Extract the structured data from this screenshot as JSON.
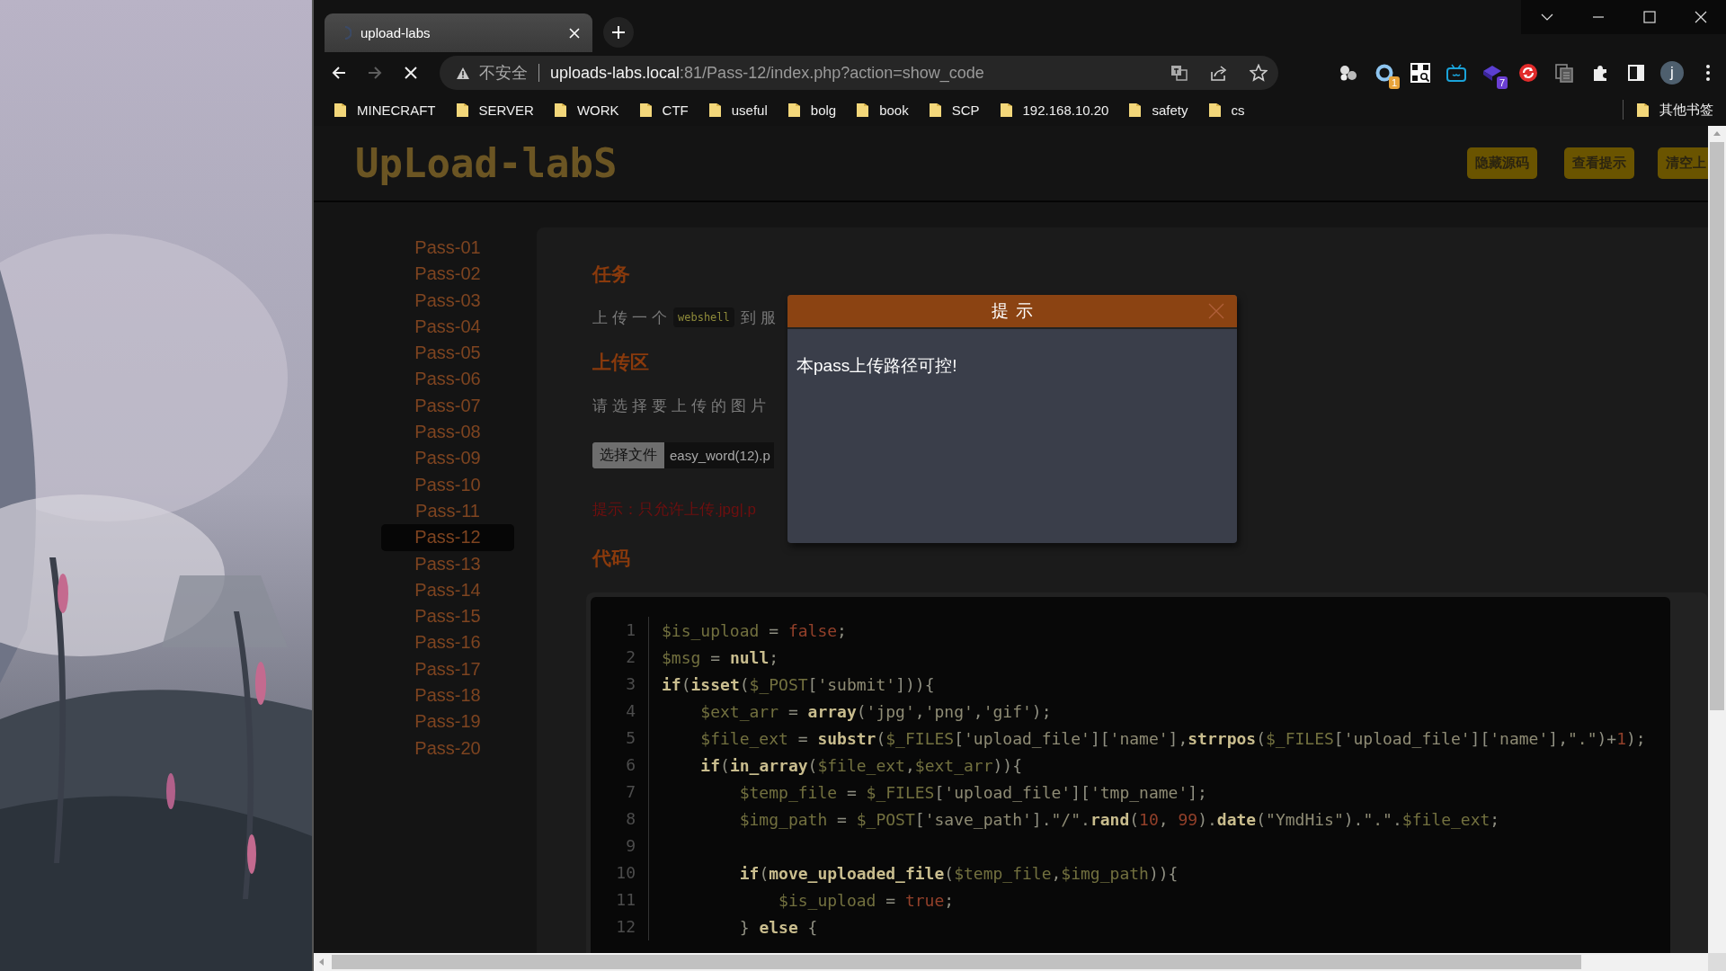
{
  "browser": {
    "tabs": [
      {
        "title": "upload-labs",
        "selected": true,
        "loading": true
      }
    ],
    "nav_buttons": [
      {
        "kind": "back",
        "disabled": false
      },
      {
        "kind": "forward",
        "disabled": true
      },
      {
        "kind": "stop",
        "disabled": false
      }
    ],
    "address_bar": {
      "security_label": "不安全",
      "host": "uploads-labs.local",
      "path": ":81/Pass-12/index.php?action=show_code"
    },
    "extensions": [
      {
        "kind": "bubbles"
      },
      {
        "kind": "ring",
        "badge": "1",
        "color": "#e8a33a"
      },
      {
        "kind": "qr"
      },
      {
        "kind": "tv"
      },
      {
        "kind": "cube",
        "badge": "7",
        "color": "#6b3fd4"
      },
      {
        "kind": "sync"
      },
      {
        "kind": "docs"
      }
    ],
    "profile_initial": "j",
    "bookmarks": [
      "MINECRAFT",
      "SERVER",
      "WORK",
      "CTF",
      "useful",
      "bolg",
      "book",
      "SCP",
      "192.168.10.20",
      "safety",
      "cs"
    ],
    "other_bookmarks": "其他书签"
  },
  "page": {
    "logo": "UpLoad-labS",
    "header_buttons": [
      "隐藏源码",
      "查看提示",
      "清空上"
    ],
    "passes": [
      {
        "label": "Pass-01",
        "selected": false
      },
      {
        "label": "Pass-02",
        "selected": false
      },
      {
        "label": "Pass-03",
        "selected": false
      },
      {
        "label": "Pass-04",
        "selected": false
      },
      {
        "label": "Pass-05",
        "selected": false
      },
      {
        "label": "Pass-06",
        "selected": false
      },
      {
        "label": "Pass-07",
        "selected": false
      },
      {
        "label": "Pass-08",
        "selected": false
      },
      {
        "label": "Pass-09",
        "selected": false
      },
      {
        "label": "Pass-10",
        "selected": false
      },
      {
        "label": "Pass-11",
        "selected": false
      },
      {
        "label": "Pass-12",
        "selected": true
      },
      {
        "label": "Pass-13",
        "selected": false
      },
      {
        "label": "Pass-14",
        "selected": false
      },
      {
        "label": "Pass-15",
        "selected": false
      },
      {
        "label": "Pass-16",
        "selected": false
      },
      {
        "label": "Pass-17",
        "selected": false
      },
      {
        "label": "Pass-18",
        "selected": false
      },
      {
        "label": "Pass-19",
        "selected": false
      },
      {
        "label": "Pass-20",
        "selected": false
      }
    ],
    "task": {
      "heading": "任务",
      "text_before": "上传一个",
      "code": "webshell",
      "text_after": "到服"
    },
    "upload": {
      "heading": "上传区",
      "prompt": "请选择要上传的图片",
      "file_button": "选择文件",
      "file_name": "easy_word(12).p",
      "hint": "提示：只允许上传.jpg|.p"
    },
    "code": {
      "heading": "代码",
      "lines": [
        {
          "number": "1",
          "segments": [
            {
              "text": "$is_upload",
              "kind": "var"
            },
            {
              "text": " = ",
              "kind": "plain"
            },
            {
              "text": "false",
              "kind": "lit"
            },
            {
              "text": ";",
              "kind": "plain"
            }
          ]
        },
        {
          "number": "2",
          "segments": [
            {
              "text": "$msg",
              "kind": "var"
            },
            {
              "text": " = ",
              "kind": "plain"
            },
            {
              "text": "null",
              "kind": "kw"
            },
            {
              "text": ";",
              "kind": "plain"
            }
          ]
        },
        {
          "number": "3",
          "segments": [
            {
              "text": "if",
              "kind": "kw"
            },
            {
              "text": "(",
              "kind": "plain"
            },
            {
              "text": "isset",
              "kind": "kw"
            },
            {
              "text": "(",
              "kind": "plain"
            },
            {
              "text": "$_POST",
              "kind": "var"
            },
            {
              "text": "[",
              "kind": "plain"
            },
            {
              "text": "'submit'",
              "kind": "str"
            },
            {
              "text": "])){",
              "kind": "plain"
            }
          ]
        },
        {
          "number": "4",
          "segments": [
            {
              "text": "    $ext_arr",
              "kind": "var"
            },
            {
              "text": " = ",
              "kind": "plain"
            },
            {
              "text": "array",
              "kind": "kw"
            },
            {
              "text": "(",
              "kind": "plain"
            },
            {
              "text": "'jpg'",
              "kind": "str"
            },
            {
              "text": ",",
              "kind": "plain"
            },
            {
              "text": "'png'",
              "kind": "str"
            },
            {
              "text": ",",
              "kind": "plain"
            },
            {
              "text": "'gif'",
              "kind": "str"
            },
            {
              "text": ");",
              "kind": "plain"
            }
          ]
        },
        {
          "number": "5",
          "segments": [
            {
              "text": "    $file_ext",
              "kind": "var"
            },
            {
              "text": " = ",
              "kind": "plain"
            },
            {
              "text": "substr",
              "kind": "kw"
            },
            {
              "text": "(",
              "kind": "plain"
            },
            {
              "text": "$_FILES",
              "kind": "var"
            },
            {
              "text": "[",
              "kind": "plain"
            },
            {
              "text": "'upload_file'",
              "kind": "str"
            },
            {
              "text": "][",
              "kind": "plain"
            },
            {
              "text": "'name'",
              "kind": "str"
            },
            {
              "text": "],",
              "kind": "plain"
            },
            {
              "text": "strrpos",
              "kind": "kw"
            },
            {
              "text": "(",
              "kind": "plain"
            },
            {
              "text": "$_FILES",
              "kind": "var"
            },
            {
              "text": "[",
              "kind": "plain"
            },
            {
              "text": "'upload_file'",
              "kind": "str"
            },
            {
              "text": "][",
              "kind": "plain"
            },
            {
              "text": "'name'",
              "kind": "str"
            },
            {
              "text": "],",
              "kind": "plain"
            },
            {
              "text": "\".\"",
              "kind": "str"
            },
            {
              "text": ")+",
              "kind": "plain"
            },
            {
              "text": "1",
              "kind": "lit"
            },
            {
              "text": ");",
              "kind": "plain"
            }
          ]
        },
        {
          "number": "6",
          "segments": [
            {
              "text": "    if",
              "kind": "kw"
            },
            {
              "text": "(",
              "kind": "plain"
            },
            {
              "text": "in_array",
              "kind": "kw"
            },
            {
              "text": "(",
              "kind": "plain"
            },
            {
              "text": "$file_ext",
              "kind": "var"
            },
            {
              "text": ",",
              "kind": "plain"
            },
            {
              "text": "$ext_arr",
              "kind": "var"
            },
            {
              "text": ")){",
              "kind": "plain"
            }
          ]
        },
        {
          "number": "7",
          "segments": [
            {
              "text": "        $temp_file",
              "kind": "var"
            },
            {
              "text": " = ",
              "kind": "plain"
            },
            {
              "text": "$_FILES",
              "kind": "var"
            },
            {
              "text": "[",
              "kind": "plain"
            },
            {
              "text": "'upload_file'",
              "kind": "str"
            },
            {
              "text": "][",
              "kind": "plain"
            },
            {
              "text": "'tmp_name'",
              "kind": "str"
            },
            {
              "text": "];",
              "kind": "plain"
            }
          ]
        },
        {
          "number": "8",
          "segments": [
            {
              "text": "        $img_path",
              "kind": "var"
            },
            {
              "text": " = ",
              "kind": "plain"
            },
            {
              "text": "$_POST",
              "kind": "var"
            },
            {
              "text": "[",
              "kind": "plain"
            },
            {
              "text": "'save_path'",
              "kind": "str"
            },
            {
              "text": "].",
              "kind": "plain"
            },
            {
              "text": "\"/\"",
              "kind": "str"
            },
            {
              "text": ".",
              "kind": "plain"
            },
            {
              "text": "rand",
              "kind": "kw"
            },
            {
              "text": "(",
              "kind": "plain"
            },
            {
              "text": "10",
              "kind": "lit"
            },
            {
              "text": ", ",
              "kind": "plain"
            },
            {
              "text": "99",
              "kind": "lit"
            },
            {
              "text": ").",
              "kind": "plain"
            },
            {
              "text": "date",
              "kind": "kw"
            },
            {
              "text": "(",
              "kind": "plain"
            },
            {
              "text": "\"YmdHis\"",
              "kind": "str"
            },
            {
              "text": ").",
              "kind": "plain"
            },
            {
              "text": "\".\"",
              "kind": "str"
            },
            {
              "text": ".",
              "kind": "plain"
            },
            {
              "text": "$file_ext",
              "kind": "var"
            },
            {
              "text": ";",
              "kind": "plain"
            }
          ]
        },
        {
          "number": "9"
        },
        {
          "number": "10",
          "segments": [
            {
              "text": "        if",
              "kind": "kw"
            },
            {
              "text": "(",
              "kind": "plain"
            },
            {
              "text": "move_uploaded_file",
              "kind": "kw"
            },
            {
              "text": "(",
              "kind": "plain"
            },
            {
              "text": "$temp_file",
              "kind": "var"
            },
            {
              "text": ",",
              "kind": "plain"
            },
            {
              "text": "$img_path",
              "kind": "var"
            },
            {
              "text": ")){",
              "kind": "plain"
            }
          ]
        },
        {
          "number": "11",
          "segments": [
            {
              "text": "            $is_upload",
              "kind": "var"
            },
            {
              "text": " = ",
              "kind": "plain"
            },
            {
              "text": "true",
              "kind": "lit"
            },
            {
              "text": ";",
              "kind": "plain"
            }
          ]
        },
        {
          "number": "12",
          "segments": [
            {
              "text": "        } ",
              "kind": "plain"
            },
            {
              "text": "else",
              "kind": "kw"
            },
            {
              "text": " {",
              "kind": "plain"
            }
          ]
        }
      ]
    }
  },
  "dialog": {
    "title": "提示",
    "message": "本pass上传路径可控!"
  }
}
